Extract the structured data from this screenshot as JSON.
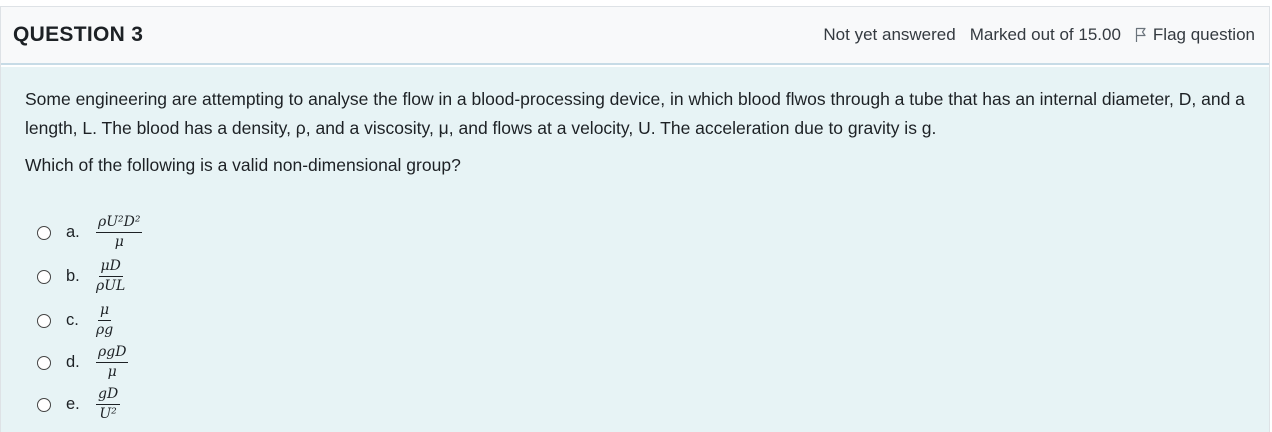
{
  "question": {
    "title": "QUESTION 3",
    "status": "Not yet answered",
    "marks": "Marked out of 15.00",
    "flag_label": "Flag question",
    "text": "Some engineering are attempting to analyse the flow in a blood-processing device, in which blood flwos through a tube that has an internal diameter, D, and a length, L. The blood has a density, ρ, and a viscosity, μ, and flows at a velocity, U. The acceleration due to gravity is g.",
    "prompt": "Which of the following is a valid non-dimensional group?"
  },
  "options": [
    {
      "letter": "a.",
      "numerator": "ρU²D²",
      "denominator": "μ"
    },
    {
      "letter": "b.",
      "numerator": "μD",
      "denominator": "ρUL"
    },
    {
      "letter": "c.",
      "numerator": "μ",
      "denominator": "ρg"
    },
    {
      "letter": "d.",
      "numerator": "ρgD",
      "denominator": "μ"
    },
    {
      "letter": "e.",
      "numerator": "gD",
      "denominator": "U²"
    }
  ],
  "colors": {
    "header_bg": "#f8f9fa",
    "body_bg": "#e7f3f5",
    "divider": "#c7dbe6",
    "text": "#1d2125"
  },
  "icons": {
    "flag": "flag-outline-icon",
    "radio": "radio-unselected"
  }
}
